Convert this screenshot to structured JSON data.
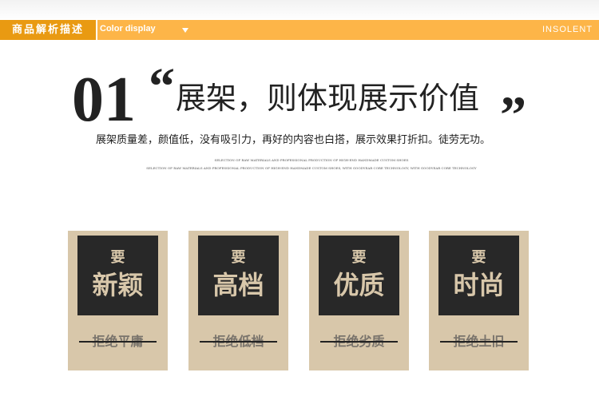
{
  "header": {
    "title": "商品解析描述",
    "subtitle": "Color display",
    "brand": "INSOLENT"
  },
  "section": {
    "number": "01",
    "open_quote": "“",
    "heading": "展架，则体现展示价值",
    "close_quote": "”",
    "description": "展架质量差，颜值低，没有吸引力，再好的内容也白搭，展示效果打折扣。徒劳无功。",
    "fine_print_1": "SELECTION OF RAW MATERIALS AND PROFESSIONAL PRODUCTION OF HIGH-END HANDMADE CUSTOM SHOES",
    "fine_print_2": "SELECTION OF RAW MATERIALS AND PROFESSIONAL PRODUCTION OF HIGH-END HANDMADE CUSTOM SHOES, WITH GOODYEAR CORE TECHNOLOGY, WITH GOODYEAR CORE TECHNOLOGY"
  },
  "cards": [
    {
      "kicker": "要",
      "title": "新颖",
      "reject": "拒绝平庸"
    },
    {
      "kicker": "要",
      "title": "高档",
      "reject": "拒绝低档"
    },
    {
      "kicker": "要",
      "title": "优质",
      "reject": "拒绝劣质"
    },
    {
      "kicker": "要",
      "title": "时尚",
      "reject": "拒绝土旧"
    }
  ],
  "colors": {
    "header_bar": "#fdb548",
    "header_title_bg": "#e99a12",
    "card_bg": "#d8c7aa",
    "card_inner": "#282828",
    "text_dark": "#222222"
  }
}
